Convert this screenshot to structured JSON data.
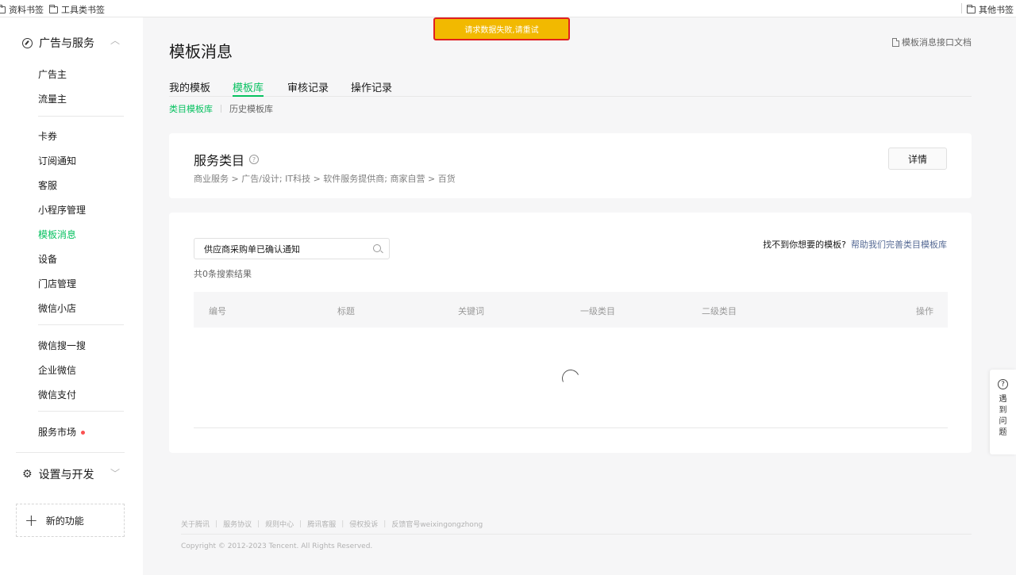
{
  "bookmarks": {
    "left": [
      "资料书签",
      "工具类书签"
    ],
    "right": "其他书签"
  },
  "sidebar": {
    "group1": "广告与服务",
    "items_a": [
      "广告主",
      "流量主"
    ],
    "items_b": [
      "卡券",
      "订阅通知",
      "客服",
      "小程序管理",
      "模板消息",
      "设备",
      "门店管理",
      "微信小店"
    ],
    "items_c": [
      "微信搜一搜",
      "企业微信",
      "微信支付"
    ],
    "service_market": "服务市场",
    "group2": "设置与开发",
    "new_features": "新的功能",
    "active_item": "模板消息"
  },
  "header": {
    "title": "模板消息",
    "doc_link": "模板消息接口文档"
  },
  "tabs": [
    "我的模板",
    "模板库",
    "审核记录",
    "操作记录"
  ],
  "active_tab": "模板库",
  "subtabs": [
    "类目模板库",
    "历史模板库"
  ],
  "category": {
    "title": "服务类目",
    "path": "商业服务 > 广告/设计; IT科技 > 软件服务提供商; 商家自营 > 百货",
    "detail_button": "详情"
  },
  "search": {
    "value": "供应商采购单已确认通知",
    "result_count": "共0条搜索结果",
    "help_prefix": "找不到你想要的模板?",
    "help_link": "帮助我们完善类目模板库"
  },
  "table": {
    "headers": [
      "编号",
      "标题",
      "关键词",
      "一级类目",
      "二级类目",
      "操作"
    ]
  },
  "toast": "请求数据失败,请重试",
  "footer": {
    "links": [
      "关于腾讯",
      "服务协议",
      "规则中心",
      "腾讯客服",
      "侵权投诉",
      "反馈官号weixingongzhong"
    ],
    "copyright": "Copyright © 2012-2023 Tencent. All Rights Reserved."
  },
  "help_float": {
    "chars": [
      "遇",
      "到",
      "问",
      "题"
    ]
  },
  "colors": {
    "accent_green": "#07c160",
    "link_blue": "#576b95",
    "toast_bg": "#f2b900",
    "toast_border": "#e02020",
    "red_dot": "#fa5151"
  },
  "icons": [
    "folder-icon",
    "compass-icon",
    "gear-icon",
    "help-icon",
    "search-icon",
    "document-icon",
    "plus-icon",
    "chevron-up-icon",
    "chevron-down-icon",
    "loading-spinner"
  ]
}
